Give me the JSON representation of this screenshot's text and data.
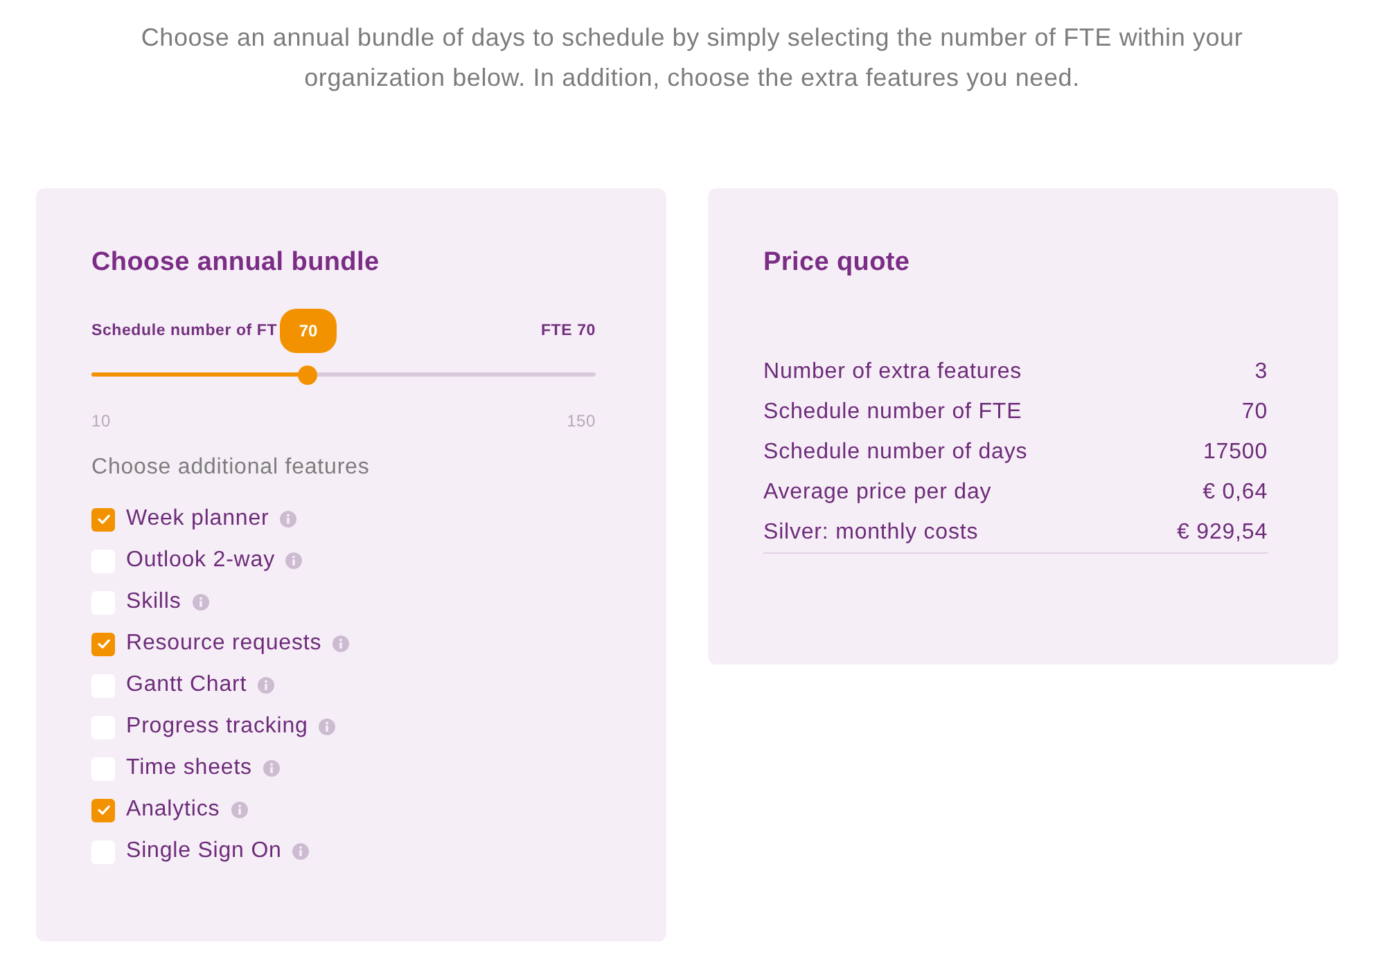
{
  "intro": "Choose an annual bundle of days to schedule by simply selecting the number of FTE within your organization below. In addition, choose the extra features you need.",
  "bundle_card": {
    "title": "Choose annual bundle",
    "slider": {
      "label": "Schedule number of FT",
      "bubble": "70",
      "reading": "FTE 70",
      "level": 0.4286,
      "min_label": "10",
      "max_label": "150"
    },
    "features_heading": "Choose additional features",
    "features": [
      {
        "label": "Week planner",
        "checked": true
      },
      {
        "label": "Outlook 2-way",
        "checked": false
      },
      {
        "label": "Skills",
        "checked": false
      },
      {
        "label": "Resource requests",
        "checked": true
      },
      {
        "label": "Gantt Chart",
        "checked": false
      },
      {
        "label": "Progress tracking",
        "checked": false
      },
      {
        "label": "Time sheets",
        "checked": false
      },
      {
        "label": "Analytics",
        "checked": true
      },
      {
        "label": "Single Sign On",
        "checked": false
      }
    ]
  },
  "quote_card": {
    "title": "Price quote",
    "rows": [
      {
        "label": "Number of extra features",
        "value": "3"
      },
      {
        "label": "Schedule number of FTE",
        "value": "70"
      },
      {
        "label": "Schedule number of days",
        "value": "17500"
      },
      {
        "label": "Average price per day",
        "value": "€ 0,64"
      },
      {
        "label": "Silver: monthly costs",
        "value": "€ 929,54"
      }
    ]
  }
}
